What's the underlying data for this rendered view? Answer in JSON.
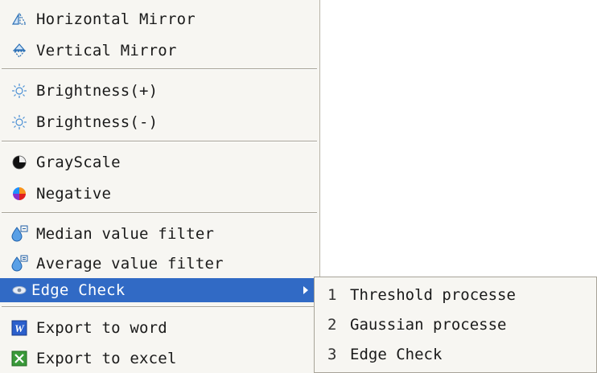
{
  "menu": {
    "items": [
      {
        "label": "Horizontal Mirror",
        "icon": "horizontal-mirror-icon"
      },
      {
        "label": "Vertical Mirror",
        "icon": "vertical-mirror-icon"
      },
      {
        "label": "Brightness(+)",
        "icon": "sun-icon"
      },
      {
        "label": "Brightness(-)",
        "icon": "sun-icon"
      },
      {
        "label": "GrayScale",
        "icon": "grayscale-icon"
      },
      {
        "label": "Negative",
        "icon": "color-wheel-icon"
      },
      {
        "label": "Median value filter",
        "icon": "water-drop-filter-icon"
      },
      {
        "label": "Average value filter",
        "icon": "water-drop-filter-icon"
      },
      {
        "label": "Edge Check",
        "icon": "eye-icon",
        "selected": true,
        "has_submenu": true
      },
      {
        "label": "Export to word",
        "icon": "word-icon"
      },
      {
        "label": "Export to excel",
        "icon": "excel-icon"
      }
    ]
  },
  "submenu": {
    "items": [
      {
        "num": "1",
        "label": "Threshold processe"
      },
      {
        "num": "2",
        "label": "Gaussian processe"
      },
      {
        "num": "3",
        "label": "Edge Check"
      }
    ]
  },
  "colors": {
    "menu_bg": "#f7f6f2",
    "highlight": "#316ac5",
    "separator": "#a7a398"
  }
}
